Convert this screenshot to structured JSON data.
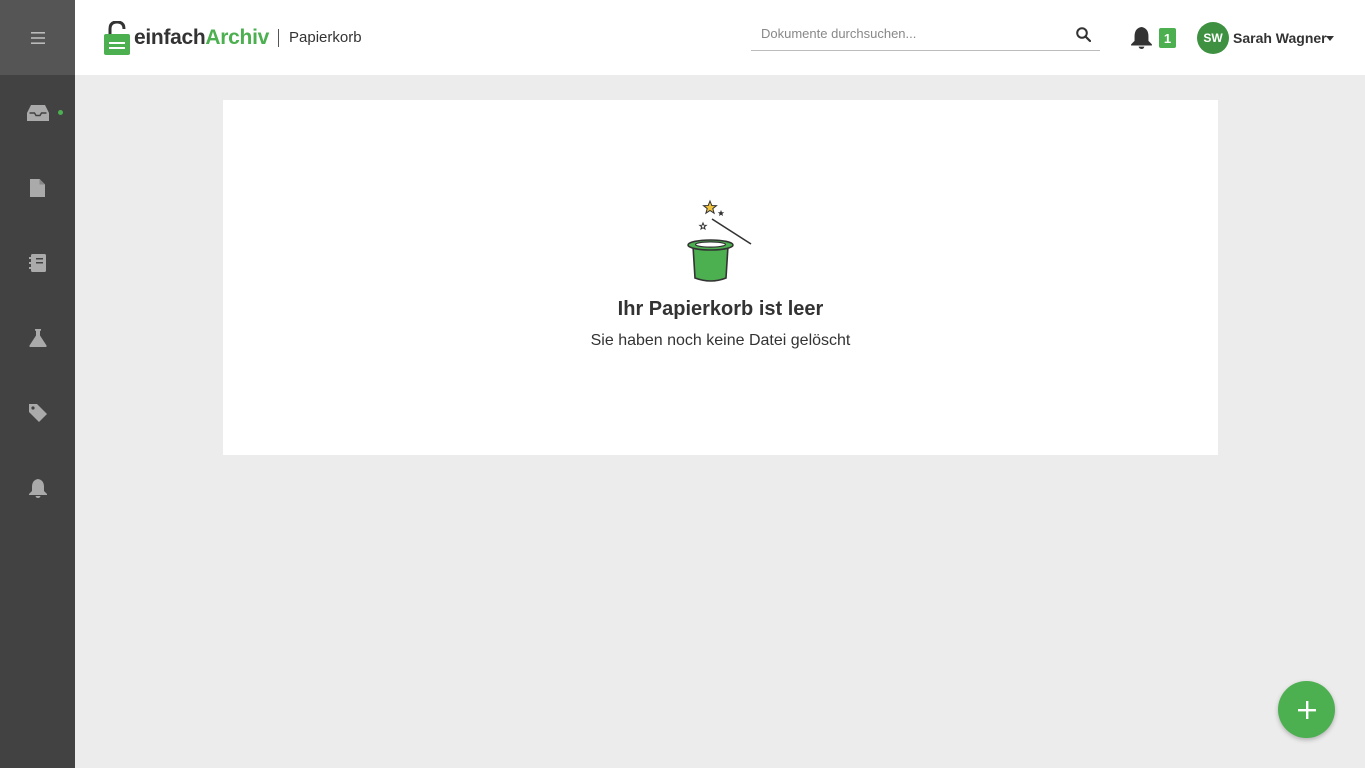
{
  "app": {
    "logo_part1": "einfach",
    "logo_part2": "Archiv",
    "page_title": "Papierkorb"
  },
  "sidebar": {
    "items": [
      {
        "icon": "menu-icon"
      },
      {
        "icon": "inbox-icon",
        "active_dot": true
      },
      {
        "icon": "document-icon"
      },
      {
        "icon": "notebook-icon"
      },
      {
        "icon": "flask-icon"
      },
      {
        "icon": "tag-icon"
      },
      {
        "icon": "bell-icon"
      }
    ]
  },
  "search": {
    "placeholder": "Dokumente durchsuchen..."
  },
  "notifications": {
    "count": "1"
  },
  "user": {
    "initials": "SW",
    "name": "Sarah Wagner"
  },
  "empty_state": {
    "title": "Ihr Papierkorb ist leer",
    "subtitle": "Sie haben noch keine Datei gelöscht",
    "illustration": "magic-hat-icon"
  },
  "fab": {
    "icon": "plus-icon"
  },
  "colors": {
    "accent": "#4caf50",
    "sidebar": "#424242",
    "background": "#ececec"
  }
}
